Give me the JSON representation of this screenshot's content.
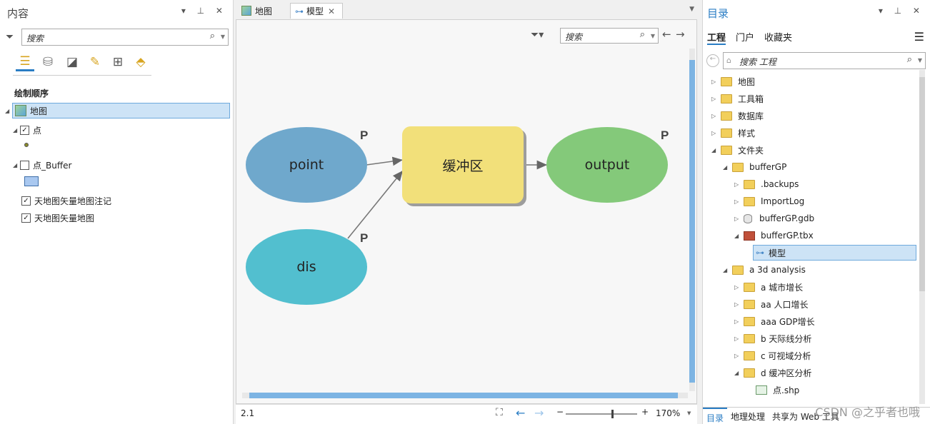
{
  "left_pane": {
    "title": "内容",
    "controls": "▾ ⊥ ✕",
    "search_placeholder": "搜索",
    "section_header": "绘制顺序",
    "layers": [
      {
        "label": "地图"
      },
      {
        "label": "点"
      },
      {
        "label": "点_Buffer"
      },
      {
        "label": "天地图矢量地图注记"
      },
      {
        "label": "天地图矢量地图"
      }
    ]
  },
  "center": {
    "tabs": [
      {
        "label": "地图"
      },
      {
        "label": "模型"
      }
    ],
    "search_placeholder": "搜索",
    "nodes": {
      "point": "point",
      "dis": "dis",
      "tool": "缓冲区",
      "output": "output"
    },
    "p_marker": "P",
    "status_left": "2.1",
    "zoom": "170%",
    "colors": {
      "point": "#6fa8cc",
      "dis": "#52bfcf",
      "tool": "#f2e07a",
      "output": "#84c97a"
    }
  },
  "right_pane": {
    "title": "目录",
    "controls": "▾ ⊥ ✕",
    "tabs": [
      "工程",
      "门户",
      "收藏夹"
    ],
    "search_placeholder": "搜索 工程",
    "tree": [
      {
        "label": "地图"
      },
      {
        "label": "工具箱"
      },
      {
        "label": "数据库"
      },
      {
        "label": "样式"
      },
      {
        "label": "文件夹"
      },
      {
        "label": "bufferGP"
      },
      {
        "label": ".backups"
      },
      {
        "label": "ImportLog"
      },
      {
        "label": "bufferGP.gdb"
      },
      {
        "label": "bufferGP.tbx"
      },
      {
        "label": "模型"
      },
      {
        "label": "a 3d analysis"
      },
      {
        "label": "a 城市增长"
      },
      {
        "label": "aa 人口增长"
      },
      {
        "label": "aaa GDP增长"
      },
      {
        "label": "b 天际线分析"
      },
      {
        "label": "c 可视域分析"
      },
      {
        "label": "d 缓冲区分析"
      },
      {
        "label": "点.shp"
      }
    ],
    "bottom_tabs": [
      "目录",
      "地理处理",
      "共享为 Web 工具"
    ],
    "watermark": "CSDN @之乎者也哦"
  }
}
